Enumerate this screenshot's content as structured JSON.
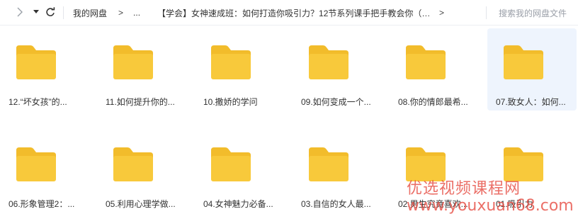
{
  "toolbar": {
    "back_icon": "chevron-right-icon",
    "dropdown_icon": "caret-down-icon",
    "refresh_icon": "refresh-icon"
  },
  "breadcrumb": {
    "root": "我的网盘",
    "arrow": ">",
    "ellipsis": "...",
    "current": "【学会】女神速成班：如何打造你吸引力？12节系列课手把手教会你（完...",
    "next_arrow": ">"
  },
  "search": {
    "placeholder": "搜索我的网盘文件"
  },
  "folders": [
    {
      "name": "12.“坏女孩”的..."
    },
    {
      "name": "11.如何提升你的..."
    },
    {
      "name": "10.撒娇的学问"
    },
    {
      "name": "09.如何变成一个..."
    },
    {
      "name": "08.你的情郎最希..."
    },
    {
      "name": "07.致女人：如何..."
    },
    {
      "name": "06.形象管理2：..."
    },
    {
      "name": "05.利用心理学做..."
    },
    {
      "name": "04.女神魅力必备..."
    },
    {
      "name": "03.自信的女人最..."
    },
    {
      "name": "02.男生究竟喜欢..."
    },
    {
      "name": "01.吸引力"
    }
  ],
  "watermark": {
    "text": "优选视频课程网",
    "url": "www.youxuan68.com"
  },
  "colors": {
    "folder_body": "#F8C93B",
    "folder_tab": "#F2BC2B",
    "selected_bg": "#EEF4FD"
  }
}
